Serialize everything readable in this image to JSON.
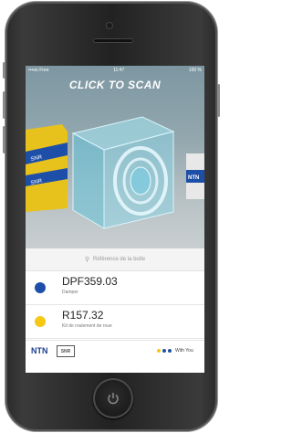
{
  "status_bar": {
    "carrier": "•••oo Free",
    "time": "11:47",
    "battery": "100 %"
  },
  "hero": {
    "title": "CLICK TO SCAN"
  },
  "search": {
    "placeholder": "Référence de la boite"
  },
  "results": [
    {
      "code": "DPF359.03",
      "description": "Damper",
      "color": "#1e4fa8"
    },
    {
      "code": "R157.32",
      "description": "Kit de roulement de roue",
      "color": "#f5c816"
    }
  ],
  "footer": {
    "brand1": "NTN",
    "brand2": "SNR",
    "tagline": "With You",
    "dot_colors": [
      "#f5c816",
      "#1e4fa8",
      "#1e4fa8"
    ]
  },
  "icons": {
    "home": "power-icon"
  }
}
